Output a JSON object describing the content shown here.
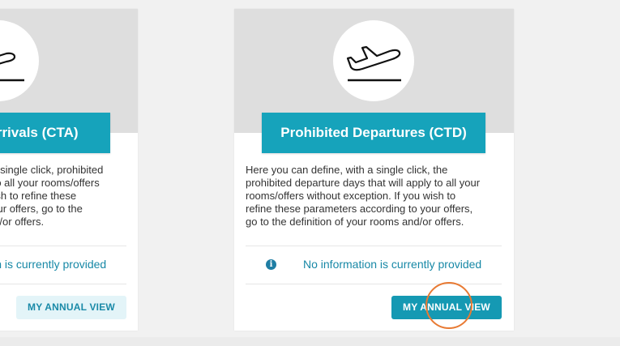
{
  "cards": [
    {
      "title": "Prohibited Arrivals (CTA)",
      "description_lines": [
        "Here you can define, with a single click, prohibited",
        "arrival days that will apply to all your rooms/offers",
        "without exception. If you wish to refine these",
        "parameters according to your offers, go to the",
        "definition of your rooms and/or offers."
      ],
      "info_text": "No information is currently provided",
      "button_label": "MY ANNUAL VIEW",
      "icon": "plane-landing-icon"
    },
    {
      "title": "Prohibited Departures (CTD)",
      "description_lines": [
        "Here you can define, with a single click, the",
        "prohibited departure days that will apply to all your",
        "rooms/offers without exception. If you wish to",
        "refine these parameters according to your offers,",
        "go to the definition of your rooms and/or offers."
      ],
      "info_text": "No information is currently provided",
      "button_label": "MY ANNUAL VIEW",
      "icon": "plane-takeoff-icon"
    }
  ],
  "colors": {
    "accent": "#16a3bb",
    "info_text": "#1788a6",
    "page_background": "#f1f1f1",
    "hero_background": "#dedede",
    "click_marker": "#e87a33"
  }
}
